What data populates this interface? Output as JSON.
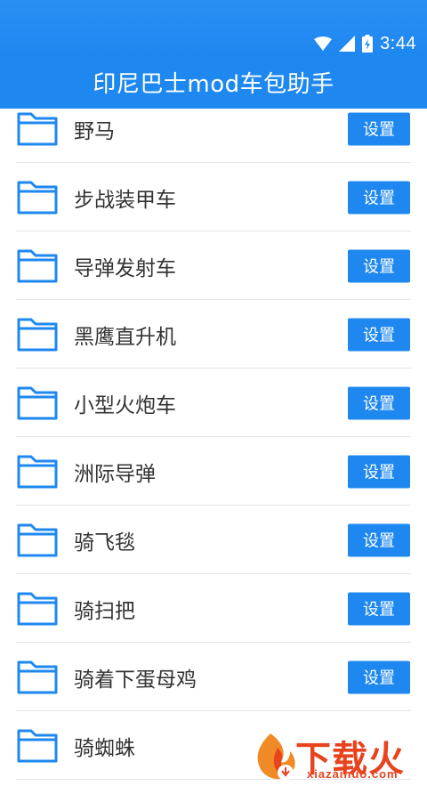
{
  "status_bar": {
    "time": "3:44",
    "icons": [
      "wifi-icon",
      "signal-icon",
      "battery-charging-icon"
    ]
  },
  "app_bar": {
    "title": "印尼巴士mod车包助手"
  },
  "list": {
    "button_label": "设置",
    "items": [
      {
        "label": "野马",
        "icon": "folder-icon"
      },
      {
        "label": "步战装甲车",
        "icon": "folder-icon"
      },
      {
        "label": "导弹发射车",
        "icon": "folder-icon"
      },
      {
        "label": "黑鹰直升机",
        "icon": "folder-icon"
      },
      {
        "label": "小型火炮车",
        "icon": "folder-icon"
      },
      {
        "label": "洲际导弹",
        "icon": "folder-icon"
      },
      {
        "label": "骑飞毯",
        "icon": "folder-icon"
      },
      {
        "label": "骑扫把",
        "icon": "folder-icon"
      },
      {
        "label": "骑着下蛋母鸡",
        "icon": "folder-icon"
      },
      {
        "label": "骑蜘蛛",
        "icon": "folder-icon"
      }
    ]
  },
  "watermark": {
    "text": "下载火",
    "url": "xiazaihuo.com"
  },
  "colors": {
    "primary": "#1e88f0",
    "text": "#333333",
    "watermark": "#e8431f"
  }
}
